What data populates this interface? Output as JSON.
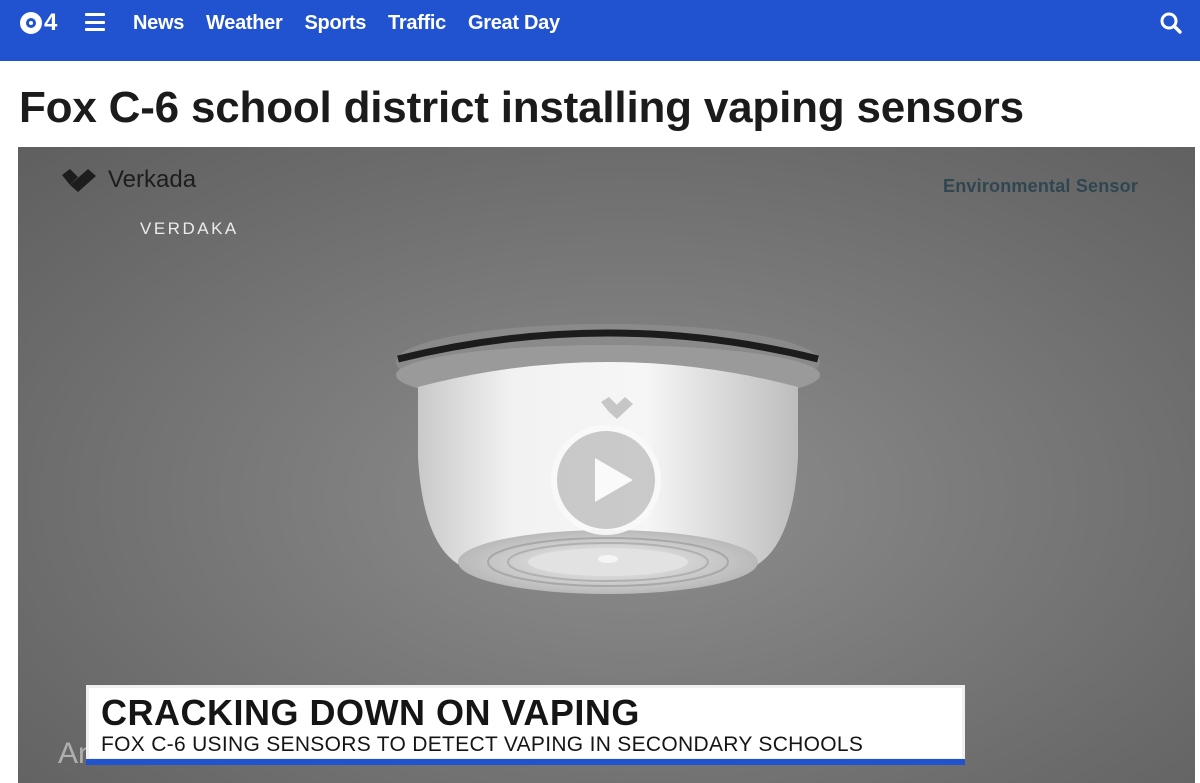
{
  "header": {
    "logo_number": "4",
    "nav": [
      "News",
      "Weather",
      "Sports",
      "Traffic",
      "Great Day"
    ],
    "accent_color": "#2152cf",
    "icons": {
      "menu": "hamburger-menu-icon",
      "search": "search-icon",
      "logo": "cbs-eye-logo"
    }
  },
  "article": {
    "headline": "Fox C-6 school district installing vaping sensors"
  },
  "video": {
    "brand_name": "Verkada",
    "brand_caption": "VERDAKA",
    "product_label": "Environmental Sensor",
    "partial_caption": "An all-in-one sensor",
    "lower_third": {
      "title": "CRACKING DOWN ON VAPING",
      "subtitle": "FOX C-6 USING SENSORS TO DETECT VAPING IN SECONDARY SCHOOLS"
    },
    "play_icon": "play-icon"
  }
}
